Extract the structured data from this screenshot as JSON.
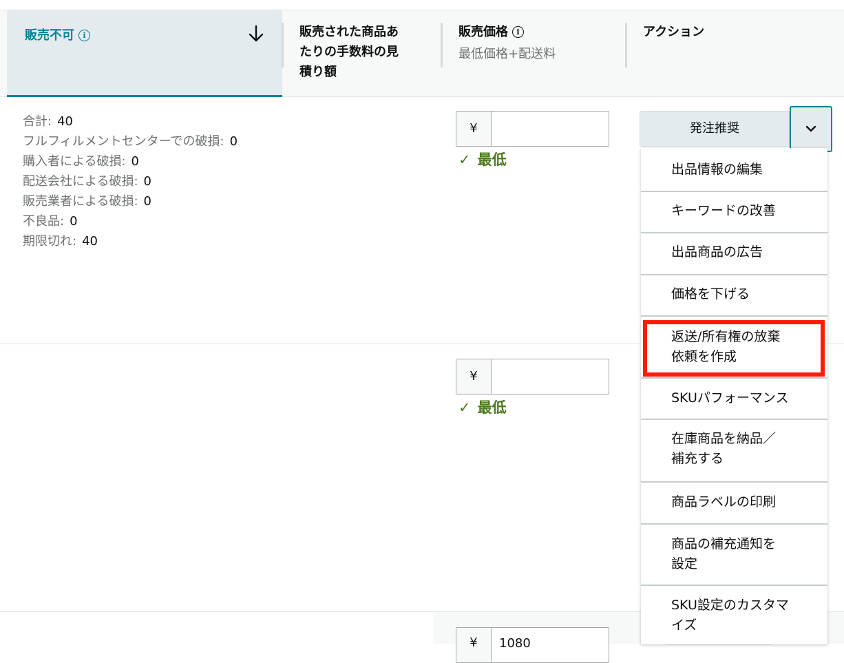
{
  "header": {
    "unsellable": {
      "label": "販売不可"
    },
    "fee_estimate": {
      "label": "販売された商品あたりの手数料の見積り額",
      "lines": [
        "販売された商品あ",
        "たりの手数料の見",
        "積り額"
      ]
    },
    "price": {
      "label": "販売価格",
      "sub": "最低価格+配送料"
    },
    "action": {
      "label": "アクション"
    }
  },
  "breakdown": [
    {
      "label": "合計:",
      "value": "40"
    },
    {
      "label": "フルフィルメントセンターでの破損:",
      "value": "0"
    },
    {
      "label": "購入者による破損:",
      "value": "0"
    },
    {
      "label": "配送会社による破損:",
      "value": "0"
    },
    {
      "label": "販売業者による破損:",
      "value": "0"
    },
    {
      "label": "不良品:",
      "value": "0"
    },
    {
      "label": "期限切れ:",
      "value": "40"
    }
  ],
  "rows": [
    {
      "currency": "¥",
      "price": "",
      "status": "最低"
    },
    {
      "currency": "¥",
      "price": "",
      "status": "最低"
    },
    {
      "currency": "¥",
      "price": "1080",
      "status": ""
    }
  ],
  "action_button": {
    "label": "発注推奨"
  },
  "menu": [
    {
      "label": "出品情報の編集",
      "lines": [
        "出品情報の編集"
      ]
    },
    {
      "label": "キーワードの改善",
      "lines": [
        "キーワードの改善"
      ]
    },
    {
      "label": "出品商品の広告",
      "lines": [
        "出品商品の広告"
      ]
    },
    {
      "label": "価格を下げる",
      "lines": [
        "価格を下げる"
      ]
    },
    {
      "label": "返送/所有権の放棄依頼を作成",
      "lines": [
        "返送/所有権の放棄",
        "依頼を作成"
      ],
      "highlighted": true
    },
    {
      "label": "SKUパフォーマンス",
      "lines": [
        "SKUパフォーマンス"
      ]
    },
    {
      "label": "在庫商品を納品/補充する",
      "lines": [
        "在庫商品を納品／",
        "補充する"
      ]
    },
    {
      "label": "商品ラベルの印刷",
      "lines": [
        "商品ラベルの印刷"
      ]
    },
    {
      "label": "商品の補充通知を設定",
      "lines": [
        "商品の補充通知を",
        "設定"
      ]
    },
    {
      "label": "SKU設定のカスタマイズ",
      "lines": [
        "SKU設定のカスタマ",
        "イズ"
      ]
    }
  ],
  "colors": {
    "accent": "#008296",
    "success": "#4c7a21",
    "highlight": "#ff1a0a"
  }
}
